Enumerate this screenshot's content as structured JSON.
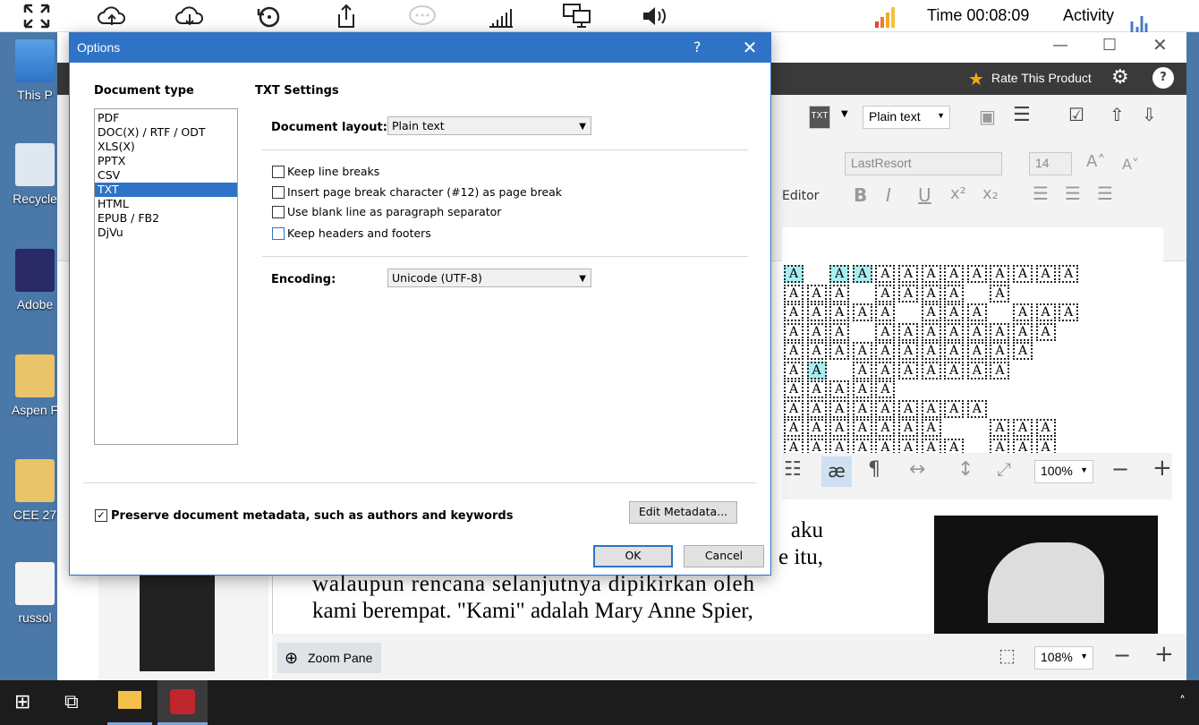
{
  "topbar": {
    "time": "Time 00:08:09",
    "activity": "Activity"
  },
  "desktop": [
    {
      "label": "This P",
      "icon": "computer-icon"
    },
    {
      "label": "Recycle",
      "icon": "recycle-bin-icon"
    },
    {
      "label": "Adobe",
      "icon": "adobe-icon"
    },
    {
      "label": "Aspen F",
      "icon": "folder-icon"
    },
    {
      "label": "CEE 27",
      "icon": "folder-icon"
    },
    {
      "label": "russol",
      "icon": "file-icon"
    }
  ],
  "app": {
    "rate": "Rate This Product",
    "format": "Plain text",
    "font": "LastResort",
    "size": "14",
    "editor": "Editor",
    "zoom_top": "100%",
    "zoom_bottom": "108%",
    "zoom_pane": "Zoom Pane",
    "text_lines": [
      "aku",
      "e itu,",
      "walaupun rencana selanjutnya dipikirkan oleh",
      "kami berempat. \"Kami\" adalah Mary Anne Spier,"
    ]
  },
  "dialog": {
    "title": "Options",
    "help": "?",
    "doc_type_label": "Document type",
    "doc_types": [
      "PDF",
      "DOC(X) / RTF / ODT",
      "XLS(X)",
      "PPTX",
      "CSV",
      "TXT",
      "HTML",
      "EPUB / FB2",
      "DjVu"
    ],
    "selected_index": 5,
    "settings_title": "TXT Settings",
    "layout_label": "Document layout:",
    "layout_value": "Plain text",
    "options": [
      {
        "label": "Keep line breaks",
        "checked": false
      },
      {
        "label": "Insert page break character (#12) as page break",
        "checked": false
      },
      {
        "label": "Use blank line as paragraph separator",
        "checked": false
      },
      {
        "label": "Keep headers and footers",
        "checked": false
      }
    ],
    "encoding_label": "Encoding:",
    "encoding_value": "Unicode (UTF-8)",
    "preserve_label": "Preserve document metadata, such as authors and keywords",
    "preserve_checked": true,
    "edit_metadata": "Edit Metadata...",
    "ok": "OK",
    "cancel": "Cancel"
  }
}
